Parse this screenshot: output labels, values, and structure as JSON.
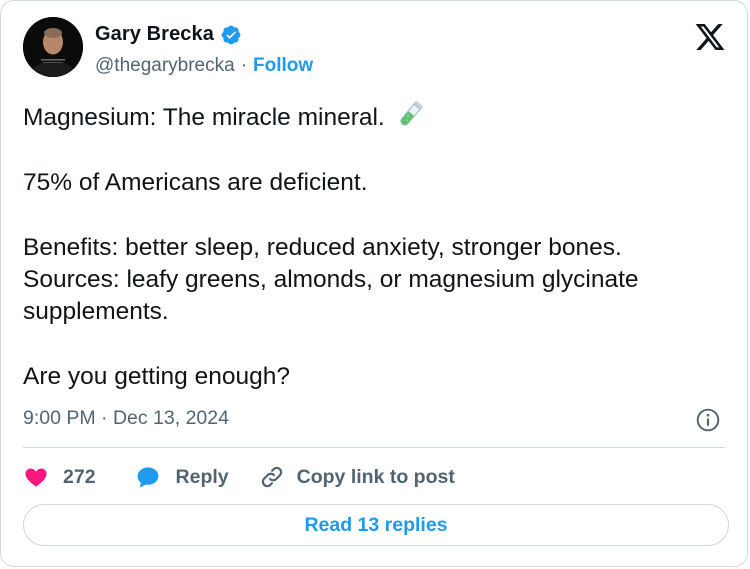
{
  "author": {
    "name": "Gary Brecka",
    "handle": "@thegarybrecka",
    "separator": "·",
    "follow_label": "Follow",
    "verified_color": "#1d9bf0"
  },
  "tweet": {
    "paragraphs": [
      "Magnesium: The miracle mineral.",
      "75% of Americans are deficient.",
      "Benefits: better sleep, reduced anxiety, stronger bones.",
      "Sources: leafy greens, almonds, or magnesium glycinate supplements.",
      "Are you getting enough?"
    ],
    "emoji": "test-tube-icon"
  },
  "meta": {
    "timestamp": "9:00 PM · Dec 13, 2024"
  },
  "actions": {
    "like_count": "272",
    "reply_label": "Reply",
    "copy_link_label": "Copy link to post",
    "read_replies_label": "Read 13 replies"
  },
  "colors": {
    "accent": "#1d9bf0",
    "like": "#f91880",
    "muted": "#536471",
    "border": "#cfd9de"
  }
}
